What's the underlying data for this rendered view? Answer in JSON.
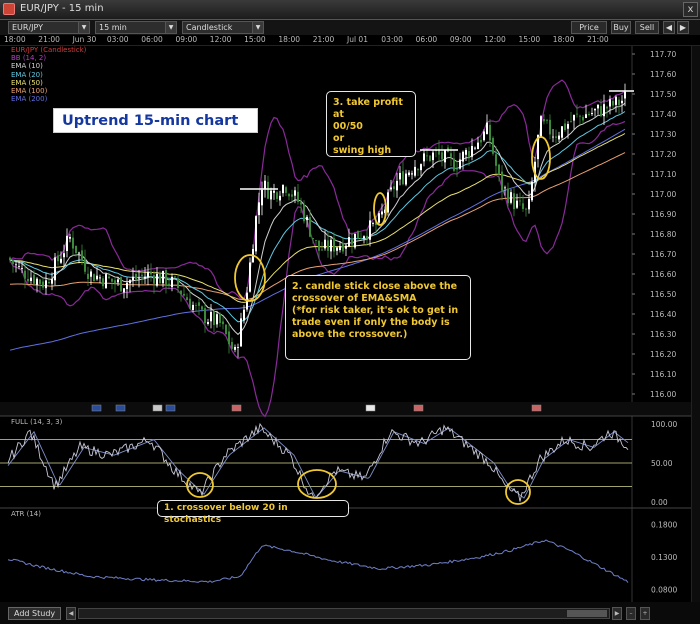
{
  "window": {
    "title": "EUR/JPY - 15 min",
    "close_label": "x"
  },
  "toolbar": {
    "symbol": "EUR/JPY",
    "interval": "15 min",
    "chart_type": "Candlestick",
    "price_box": "Price Box",
    "buy": "Buy",
    "sell": "Sell"
  },
  "time_axis": [
    "18:00",
    "21:00",
    "Jun 30",
    "03:00",
    "06:00",
    "09:00",
    "12:00",
    "15:00",
    "18:00",
    "21:00",
    "Jul 01",
    "03:00",
    "06:00",
    "09:00",
    "12:00",
    "15:00",
    "18:00",
    "21:00"
  ],
  "price_axis": [
    "117.70",
    "117.60",
    "117.50",
    "117.40",
    "117.30",
    "117.20",
    "117.10",
    "117.00",
    "116.90",
    "116.80",
    "116.70",
    "116.60",
    "116.50",
    "116.40",
    "116.30",
    "116.20",
    "116.10",
    "116.00"
  ],
  "legend": [
    {
      "text": "EUR/JPY (Candlestick)",
      "color": "#d23c3c"
    },
    {
      "text": "BB (14, 2)",
      "color": "#b040c0"
    },
    {
      "text": "EMA (10)",
      "color": "#d0d0d0"
    },
    {
      "text": "EMA (20)",
      "color": "#60c8e0"
    },
    {
      "text": "EMA (50)",
      "color": "#e8e070"
    },
    {
      "text": "EMA (100)",
      "color": "#e8a070"
    },
    {
      "text": "EMA (200)",
      "color": "#6070e0"
    }
  ],
  "stoch": {
    "label": "FULL (14, 3, 3)",
    "axis": [
      "100.00",
      "50.00",
      "0.00"
    ]
  },
  "atr": {
    "label": "ATR (14)",
    "axis": [
      "0.1800",
      "0.1300",
      "0.0800"
    ]
  },
  "annotations": {
    "title": "Uptrend 15-min chart",
    "note1": "1. crossover below 20 in stochastics",
    "note2": [
      "2. candle stick close above the",
      "crossover of EMA&SMA",
      "(*for risk taker, it's ok to get in",
      "trade even if only the body is",
      "above the crossover.)"
    ],
    "note3": [
      "3. take profit at",
      "00/50",
      "or",
      "swing high"
    ]
  },
  "colors": {
    "candle_up": "#ffffff",
    "candle_down": "#3a8a3a",
    "bollinger": "#8a2a9a",
    "ema10": "#d0d0d0",
    "ema20": "#60c8e0",
    "ema50": "#e8e070",
    "ema100": "#e8a070",
    "ema200": "#6070e0",
    "stoch_line": "#c8c8d8",
    "atr_line": "#7080c8",
    "highlight": "#f0c832"
  },
  "statusbar": {
    "add_study": "Add Study"
  }
}
